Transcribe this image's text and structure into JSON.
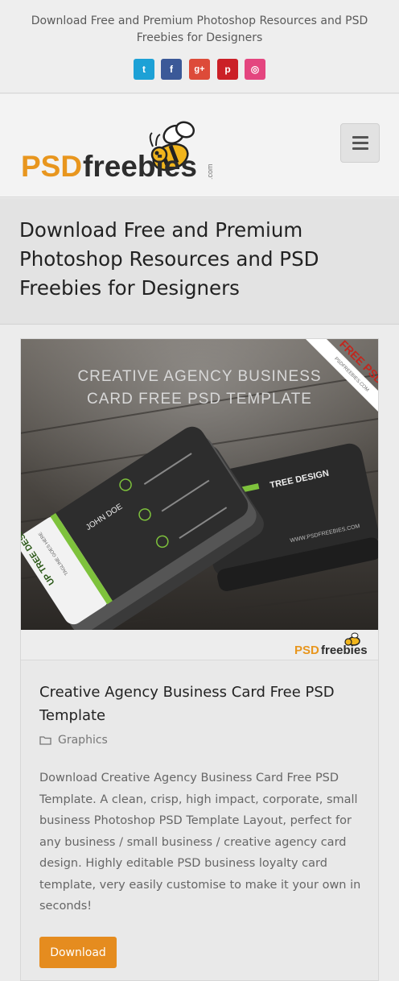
{
  "topbar": {
    "tagline": "Download Free and Premium Photoshop Resources and PSD Freebies for Designers",
    "social": [
      {
        "name": "twitter-icon",
        "glyph": "t",
        "color": "#1da1d6"
      },
      {
        "name": "facebook-icon",
        "glyph": "f",
        "color": "#3b5998"
      },
      {
        "name": "google-plus-icon",
        "glyph": "g+",
        "color": "#dd4b39"
      },
      {
        "name": "pinterest-icon",
        "glyph": "p",
        "color": "#cb2027"
      },
      {
        "name": "dribbble-icon",
        "glyph": "◎",
        "color": "#e4457f"
      }
    ]
  },
  "header": {
    "logo": {
      "psd": "PSD",
      "freebies": "freebies",
      "dotcom": ".com"
    },
    "menu_icon": "hamburger-icon"
  },
  "page": {
    "title": "Download Free and Premium Photoshop Resources and PSD Freebies for Designers"
  },
  "post": {
    "image": {
      "headline_line1": "CREATIVE AGENCY BUSINESS",
      "headline_line2": "CARD FREE PSD TEMPLATE",
      "ribbon": "FREE PSD",
      "ribbon_sub": "PSDFREEBIES.COM",
      "card_brand": "UP TREE DESIGN",
      "card_tagline": "TAGLINE GOES HERE",
      "card_name": "JOHN DOE",
      "card_website": "WWW.PSDFREEBIES.COM"
    },
    "brand": {
      "psd": "PSD",
      "freebies": "freebies"
    },
    "title": "Creative Agency Business Card Free PSD Template",
    "category": "Graphics",
    "category_icon": "folder-icon",
    "excerpt": "Download Creative Agency Business Card Free PSD Template. A clean, crisp, high impact, corporate, small business Photoshop PSD Template Layout, perfect for any business / small business / creative agency card design. Highly editable PSD business loyalty card template, very easily customise to make it your own in seconds!",
    "download_label": "Download"
  },
  "colors": {
    "accent_orange": "#e58c1f",
    "logo_orange": "#e8961e",
    "logo_dark": "#2d2d2d",
    "card_green": "#7ec23c"
  }
}
